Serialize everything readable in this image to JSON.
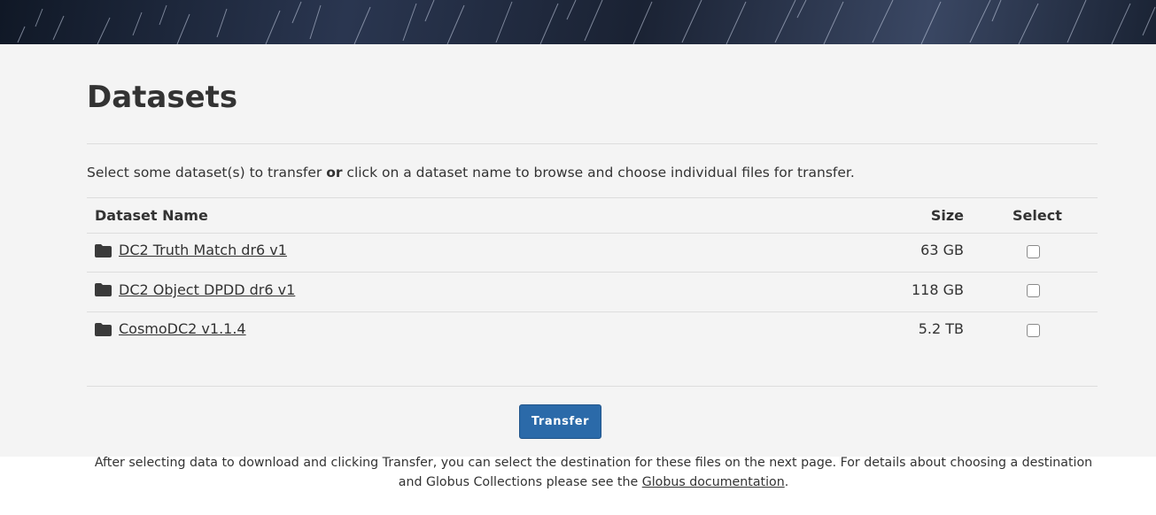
{
  "page": {
    "title": "Datasets",
    "intro_before": "Select some dataset(s) to transfer ",
    "intro_bold": "or",
    "intro_after": " click on a dataset name to browse and choose individual files for transfer."
  },
  "table": {
    "headers": {
      "name": "Dataset Name",
      "size": "Size",
      "select": "Select"
    },
    "rows": [
      {
        "name": "DC2 Truth Match dr6 v1",
        "size": "63 GB",
        "selected": false
      },
      {
        "name": "DC2 Object DPDD dr6 v1",
        "size": "118 GB",
        "selected": false
      },
      {
        "name": "CosmoDC2 v1.1.4",
        "size": "5.2 TB",
        "selected": false
      }
    ]
  },
  "actions": {
    "transfer_label": "Transfer"
  },
  "footer": {
    "text_before": "After selecting data to download and clicking Transfer, you can select the destination for these files on the next page. For details about choosing a destination and Globus Collections please see the ",
    "link_label": "Globus documentation",
    "text_after": "."
  },
  "icons": {
    "dataset": "folder-icon"
  },
  "colors": {
    "accent": "#2b6aa9",
    "panel": "#f4f4f4",
    "text": "#333333"
  }
}
